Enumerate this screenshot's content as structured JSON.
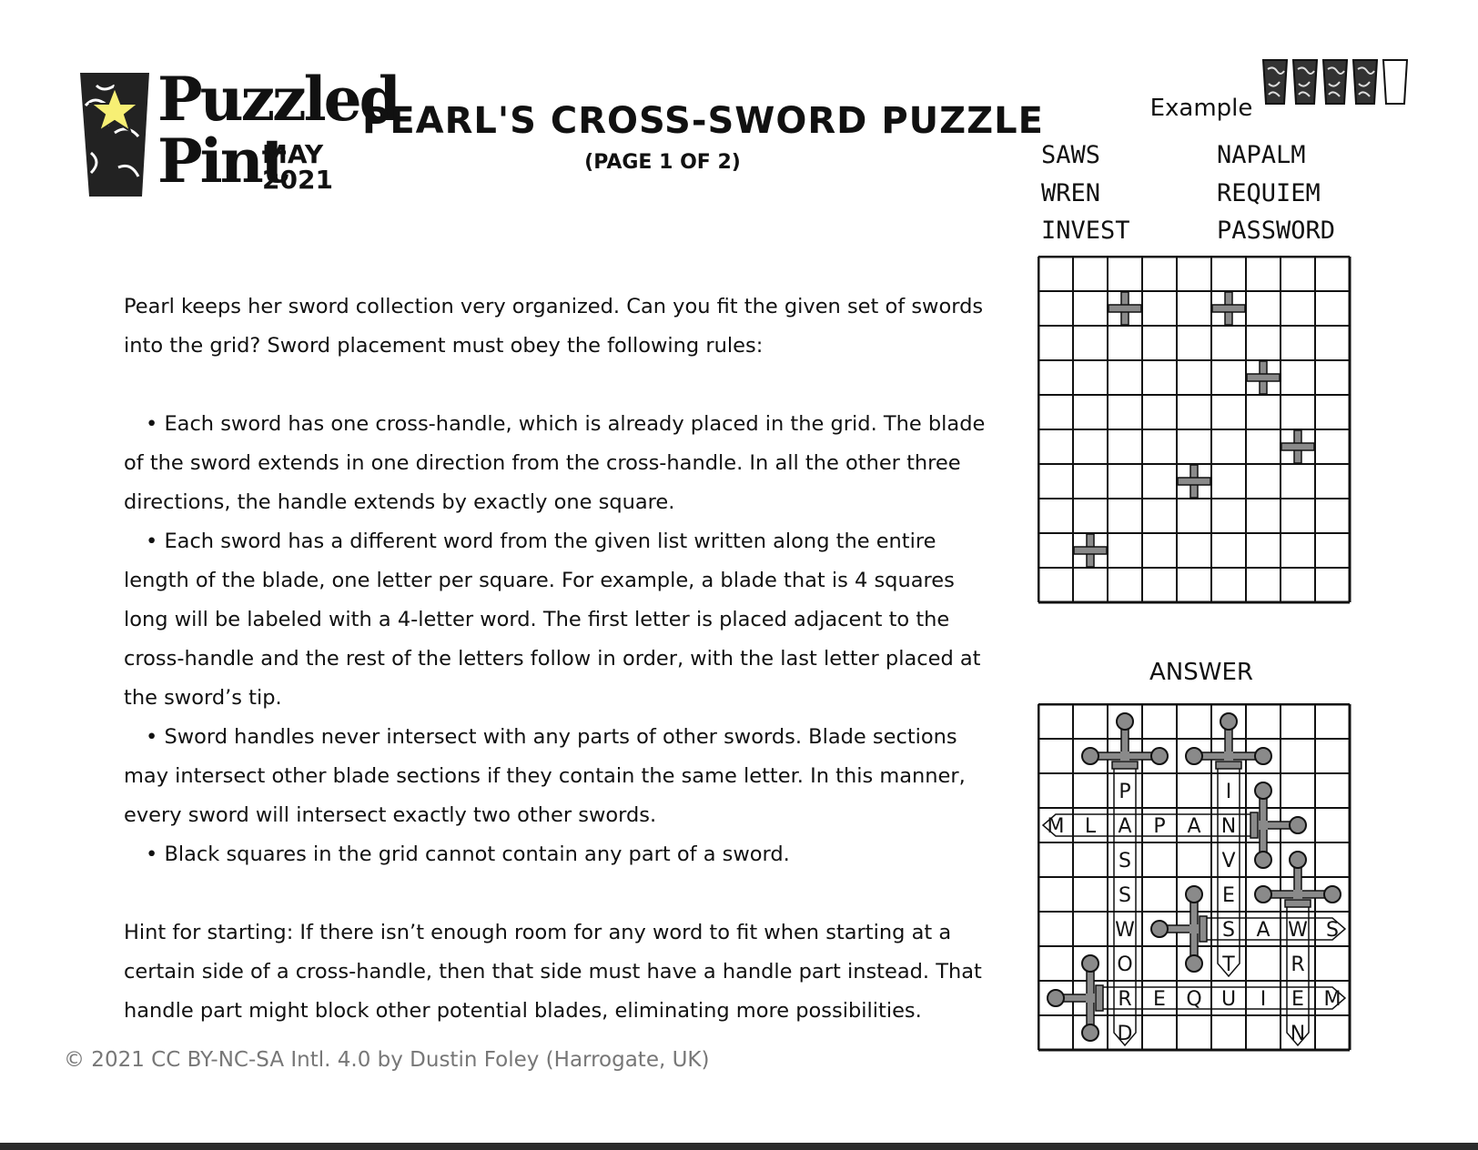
{
  "logo": {
    "line1": "Puzzled",
    "line2": "Pint",
    "month": "MAY",
    "year": "2021",
    "star_color": "#f7ef74"
  },
  "header": {
    "title": "PEARL'S CROSS-SWORD  PUZZLE",
    "subtitle": "(PAGE 1 OF 2)"
  },
  "difficulty": {
    "filled": 4,
    "total": 5
  },
  "intro": [
    "Pearl keeps her sword collection very organized. Can you fit the given set of swords into the grid? Sword placement must obey the following rules:"
  ],
  "rules": [
    "Each sword has one cross-handle, which is already placed in the grid. The blade of the sword extends in one direction from the cross-handle. In all the other three directions, the handle extends by exactly one square.",
    "Each sword has a different word from the given list written along the entire length of the blade, one letter per square. For example, a blade that is 4 squares long will be labeled with a 4-letter word. The first letter is placed adjacent to the cross-handle and the rest of the letters follow in order, with the last letter placed at the sword’s tip.",
    "Sword handles never intersect with any parts of other swords. Blade sections may intersect other blade sections if they contain the same letter. In this manner, every sword will intersect exactly two other swords.",
    "Black squares in the grid cannot contain any part of a sword."
  ],
  "bullet": "•",
  "hint": "Hint for starting: If there isn’t enough room for any word to fit when starting at a certain side of a cross-handle, then that side must have a handle part instead. That handle part might block other potential blades, eliminating more possibilities.",
  "footer": "© 2021 CC BY-NC-SA Intl. 4.0 by Dustin Foley (Harrogate, UK)",
  "example": {
    "label": "Example",
    "words": [
      "SAWS",
      "NAPALM",
      "WREN",
      "REQUIEM",
      "INVEST",
      "PASSWORD"
    ],
    "rows": 10,
    "cols": 9,
    "crosses": [
      [
        1,
        2
      ],
      [
        1,
        5
      ],
      [
        3,
        6
      ],
      [
        5,
        7
      ],
      [
        6,
        4
      ],
      [
        8,
        1
      ]
    ]
  },
  "answer": {
    "label": "ANSWER",
    "rows": 10,
    "cols": 9,
    "letters": [
      {
        "r": 2,
        "c": 2,
        "ch": "P"
      },
      {
        "r": 3,
        "c": 2,
        "ch": "A"
      },
      {
        "r": 4,
        "c": 2,
        "ch": "S"
      },
      {
        "r": 5,
        "c": 2,
        "ch": "S"
      },
      {
        "r": 6,
        "c": 2,
        "ch": "W"
      },
      {
        "r": 7,
        "c": 2,
        "ch": "O"
      },
      {
        "r": 8,
        "c": 2,
        "ch": "R"
      },
      {
        "r": 9,
        "c": 2,
        "ch": "D"
      },
      {
        "r": 2,
        "c": 5,
        "ch": "I"
      },
      {
        "r": 3,
        "c": 5,
        "ch": "N"
      },
      {
        "r": 4,
        "c": 5,
        "ch": "V"
      },
      {
        "r": 5,
        "c": 5,
        "ch": "E"
      },
      {
        "r": 6,
        "c": 5,
        "ch": "S"
      },
      {
        "r": 7,
        "c": 5,
        "ch": "T"
      },
      {
        "r": 3,
        "c": 0,
        "ch": "M"
      },
      {
        "r": 3,
        "c": 1,
        "ch": "L"
      },
      {
        "r": 3,
        "c": 3,
        "ch": "P"
      },
      {
        "r": 3,
        "c": 4,
        "ch": "A"
      },
      {
        "r": 6,
        "c": 6,
        "ch": "A"
      },
      {
        "r": 6,
        "c": 7,
        "ch": "W"
      },
      {
        "r": 6,
        "c": 8,
        "ch": "S"
      },
      {
        "r": 7,
        "c": 7,
        "ch": "R"
      },
      {
        "r": 8,
        "c": 7,
        "ch": "E"
      },
      {
        "r": 9,
        "c": 7,
        "ch": "N"
      },
      {
        "r": 8,
        "c": 3,
        "ch": "E"
      },
      {
        "r": 8,
        "c": 4,
        "ch": "Q"
      },
      {
        "r": 8,
        "c": 5,
        "ch": "U"
      },
      {
        "r": 8,
        "c": 6,
        "ch": "I"
      },
      {
        "r": 8,
        "c": 8,
        "ch": "M"
      }
    ],
    "swords": [
      {
        "r": 1,
        "c": 2,
        "blade": "down",
        "tip": [
          9,
          2
        ]
      },
      {
        "r": 1,
        "c": 5,
        "blade": "down",
        "tip": [
          7,
          5
        ]
      },
      {
        "r": 3,
        "c": 6,
        "blade": "left",
        "tip": [
          3,
          0
        ]
      },
      {
        "r": 5,
        "c": 7,
        "blade": "down",
        "tip": [
          9,
          7
        ]
      },
      {
        "r": 6,
        "c": 4,
        "blade": "right",
        "tip": [
          6,
          8
        ]
      },
      {
        "r": 8,
        "c": 1,
        "blade": "right",
        "tip": [
          8,
          8
        ]
      }
    ]
  }
}
